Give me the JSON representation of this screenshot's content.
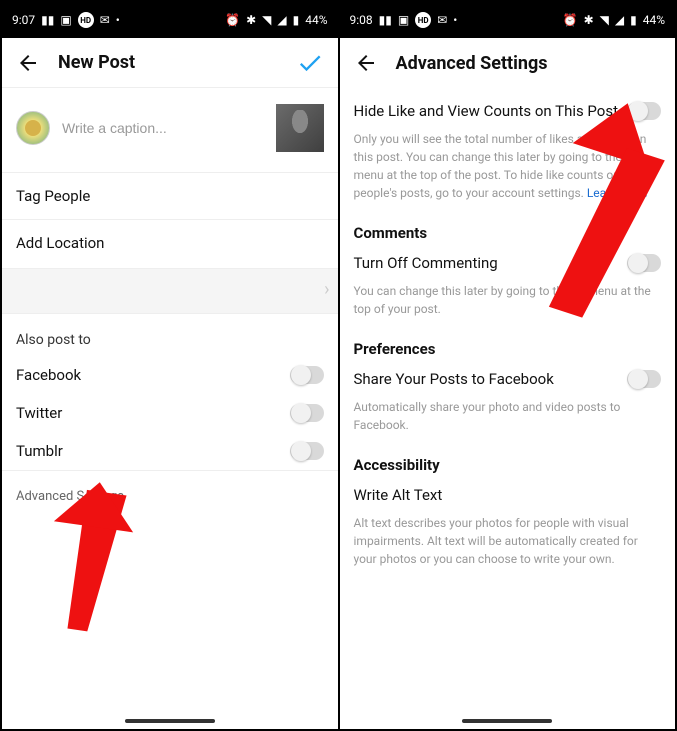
{
  "left": {
    "status": {
      "time": "9:07",
      "battery": "44%"
    },
    "header": {
      "title": "New Post"
    },
    "caption_placeholder": "Write a caption...",
    "rows": {
      "tag_people": "Tag People",
      "add_location": "Add Location"
    },
    "also_post_to_label": "Also post to",
    "share": {
      "facebook": "Facebook",
      "twitter": "Twitter",
      "tumblr": "Tumblr"
    },
    "advanced_link": "Advanced Settings"
  },
  "right": {
    "status": {
      "time": "9:08",
      "battery": "44%"
    },
    "header": {
      "title": "Advanced Settings"
    },
    "hide_counts": {
      "title": "Hide Like and View Counts on This Post",
      "desc": "Only you will see the total number of likes and views on this post. You can change this later by going to the ⋮ menu at the top of the post. To hide like counts on other people's posts, go to your account settings.",
      "learn_more": "Learn More"
    },
    "comments_head": "Comments",
    "commenting": {
      "title": "Turn Off Commenting",
      "desc": "You can change this later by going to the ⋮ menu at the top of your post."
    },
    "prefs_head": "Preferences",
    "share_fb": {
      "title": "Share Your Posts to Facebook",
      "desc": "Automatically share your photo and video posts to Facebook."
    },
    "a11y_head": "Accessibility",
    "alt_text": {
      "title": "Write Alt Text",
      "desc": "Alt text describes your photos for people with visual impairments. Alt text will be automatically created for your photos or you can choose to write your own."
    }
  }
}
